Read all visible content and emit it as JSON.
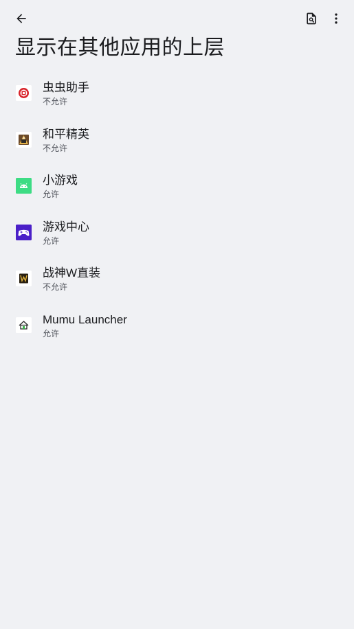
{
  "header": {
    "title": "显示在其他应用的上层"
  },
  "icons": {
    "back": "arrow-back-icon",
    "search": "search-in-page-icon",
    "more": "more-vert-icon"
  },
  "apps": [
    {
      "name": "虫虫助手",
      "status": "不允许",
      "icon": "chongchong-icon"
    },
    {
      "name": "和平精英",
      "status": "不允许",
      "icon": "heping-icon"
    },
    {
      "name": "小游戏",
      "status": "允许",
      "icon": "android-icon"
    },
    {
      "name": "游戏中心",
      "status": "允许",
      "icon": "gamepad-icon"
    },
    {
      "name": "战神W直装",
      "status": "不允许",
      "icon": "zhanshen-icon"
    },
    {
      "name": "Mumu Launcher",
      "status": "允许",
      "icon": "home-icon"
    }
  ]
}
